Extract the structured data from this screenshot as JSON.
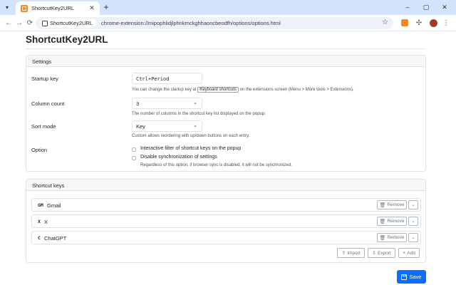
{
  "browser": {
    "tab_title": "ShortcutKey2URL",
    "new_tab_glyph": "+",
    "window_controls": [
      "–",
      "▢",
      "✕"
    ],
    "nav": {
      "back": "←",
      "forward": "→",
      "reload": "⟳"
    },
    "omnibox": {
      "chip_label": "ShortcutKey2URL",
      "url": "chrome-extension://mipophlidjlphnkmckghhaoncbeodfh/options/options.html"
    },
    "icons": [
      "star-icon",
      "extension-icon",
      "puzzle-icon",
      "profile-avatar",
      "menu-icon"
    ]
  },
  "page": {
    "title": "ShortcutKey2URL",
    "settings": {
      "header": "Settings",
      "startup_key": {
        "label": "Startup key",
        "value": "Ctrl+Period",
        "help_before": "You can change the startup key at",
        "help_button": "Keyboard shortcuts",
        "help_after": "on the extensions screen (Menu > More tools > Extensions)."
      },
      "column_count": {
        "label": "Column count",
        "value": "3",
        "help": "The number of columns in the shortcut key list displayed on the popup."
      },
      "sort_mode": {
        "label": "Sort mode",
        "value": "Key",
        "help": "Custom allows reordering with up/down buttons on each entry."
      },
      "option": {
        "label": "Option",
        "filter_label": "Interactive filter of shortcut keys on the popup",
        "filter_checked": false,
        "sync_label": "Disable synchronization of settings",
        "sync_checked": false,
        "sync_help": "Regardless of this option, if browser sync is disabled, it will not be synchronized."
      }
    },
    "shortcut_keys": {
      "header": "Shortcut keys",
      "items": [
        {
          "key": "GM",
          "name": "Gmail"
        },
        {
          "key": "X",
          "name": "X"
        },
        {
          "key": "C",
          "name": "ChatGPT"
        }
      ],
      "remove_label": "Remove",
      "import_label": "Import",
      "export_label": "Export",
      "add_label": "Add"
    },
    "save_label": "Save",
    "accent_color": "#0d6efd"
  }
}
